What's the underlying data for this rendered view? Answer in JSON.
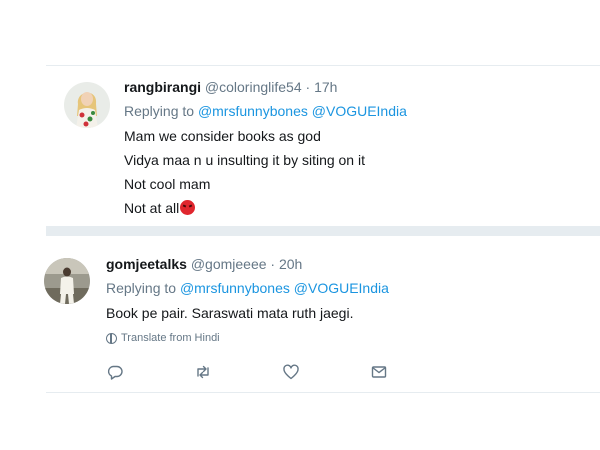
{
  "tweets": [
    {
      "name": "rangbirangi",
      "handle": "@coloringlife54",
      "separator": "·",
      "time": "17h",
      "replying_prefix": "Replying to",
      "mentions": [
        "@mrsfunnybones",
        "@VOGUEIndia"
      ],
      "lines": [
        "Mam we consider books as god",
        "Vidya maa n u insulting it by siting on it",
        "Not cool mam",
        "Not at all"
      ],
      "emoji": "angry-face"
    },
    {
      "name": "gomjeetalks",
      "handle": "@gomjeeee",
      "separator": "·",
      "time": "20h",
      "replying_prefix": "Replying to",
      "mentions": [
        "@mrsfunnybones",
        "@VOGUEIndia"
      ],
      "lines": [
        "Book pe pair. Saraswati mata ruth jaegi."
      ],
      "translate": "Translate from Hindi",
      "actions": [
        "reply-icon",
        "retweet-icon",
        "like-icon",
        "message-icon"
      ]
    }
  ],
  "colors": {
    "link": "#1b95e0",
    "muted": "#657786",
    "text": "#14171a",
    "divider": "#e6ecf0"
  }
}
